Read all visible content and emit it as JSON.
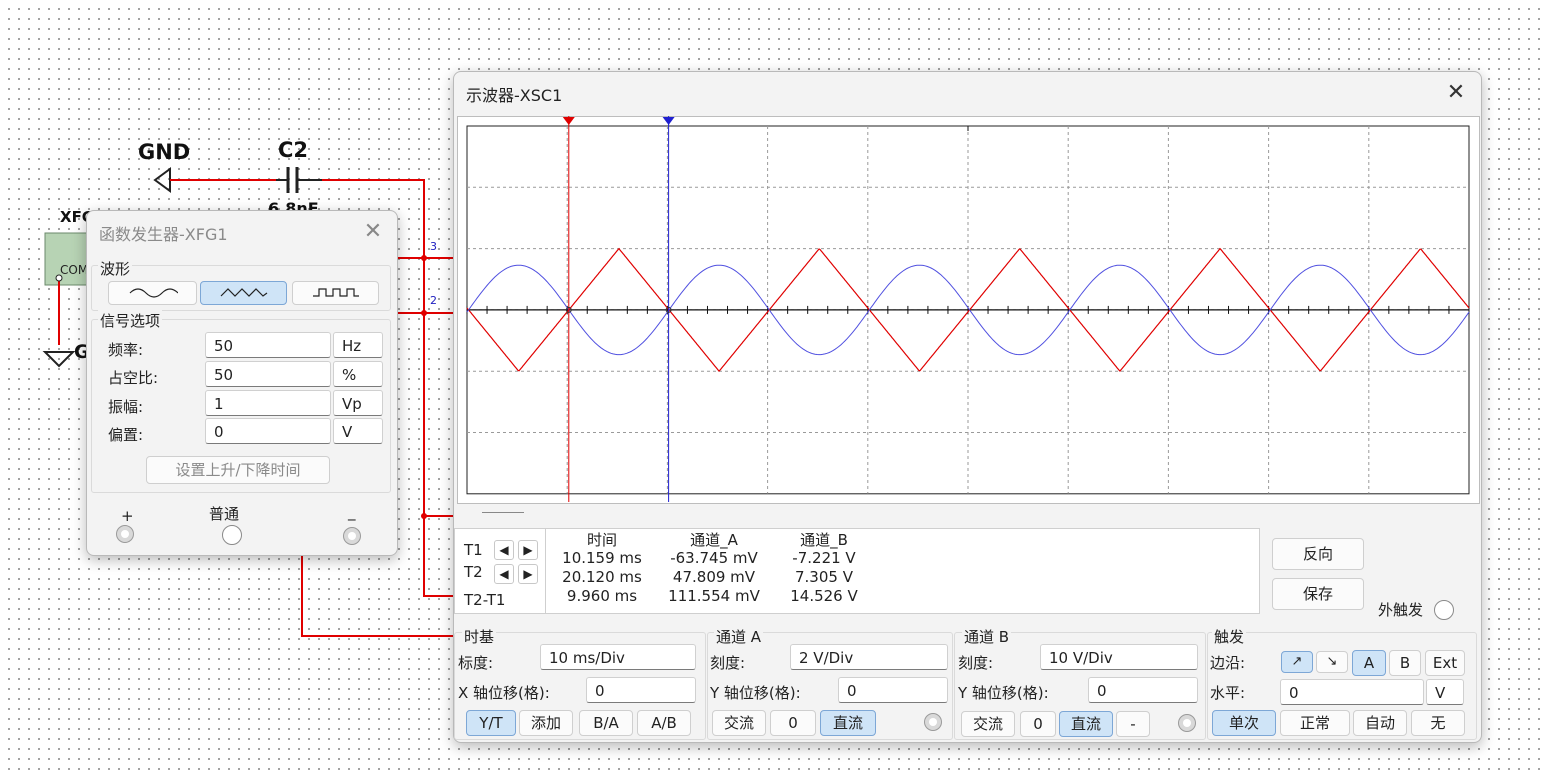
{
  "schematic": {
    "gnd_label": "GND",
    "capacitor_name": "C2",
    "capacitor_value": "6.8nF",
    "generator_ref": "XFG1",
    "generator_com": "COM",
    "node_3": "3",
    "node_2": "2",
    "gnd_partial": "G"
  },
  "function_generator": {
    "title": "函数发生器-XFG1",
    "waveform_section": "波形",
    "waveforms": [
      {
        "icon": "sine-wave-icon",
        "selected": false
      },
      {
        "icon": "triangle-wave-icon",
        "selected": true
      },
      {
        "icon": "square-wave-icon",
        "selected": false
      }
    ],
    "signal_section": "信号选项",
    "params": [
      {
        "label": "频率:",
        "value": "50",
        "unit": "Hz"
      },
      {
        "label": "占空比:",
        "value": "50",
        "unit": "%"
      },
      {
        "label": "振幅:",
        "value": "1",
        "unit": "Vp"
      },
      {
        "label": "偏置:",
        "value": "0",
        "unit": "V"
      }
    ],
    "rise_fall_button": "设置上升/下降时间",
    "terminals": {
      "plus": "+",
      "common": "普通",
      "minus": "_"
    }
  },
  "oscilloscope": {
    "title": "示波器-XSC1",
    "measurements": {
      "headers": [
        "时间",
        "通道_A",
        "通道_B"
      ],
      "rows": [
        {
          "label": "T1",
          "time": "10.159 ms",
          "a": "-63.745 mV",
          "b": "-7.221 V"
        },
        {
          "label": "T2",
          "time": "20.120 ms",
          "a": "47.809 mV",
          "b": "7.305 V"
        },
        {
          "label": "T2-T1",
          "time": "9.960 ms",
          "a": "111.554 mV",
          "b": "14.526 V"
        }
      ]
    },
    "reverse_button": "反向",
    "save_button": "保存",
    "ext_trigger": "外触发",
    "timebase": {
      "title": "时基",
      "scale_label": "标度:",
      "scale_value": "10 ms/Div",
      "xpos_label": "X 轴位移(格):",
      "xpos_value": "0",
      "modes": [
        {
          "label": "Y/T",
          "selected": true
        },
        {
          "label": "添加",
          "selected": false
        },
        {
          "label": "B/A",
          "selected": false
        },
        {
          "label": "A/B",
          "selected": false
        }
      ]
    },
    "channel_a": {
      "title": "通道 A",
      "scale_label": "刻度:",
      "scale_value": "2  V/Div",
      "ypos_label": "Y 轴位移(格):",
      "ypos_value": "0",
      "coupling": [
        {
          "label": "交流",
          "selected": false
        },
        {
          "label": "0",
          "selected": false
        },
        {
          "label": "直流",
          "selected": true
        }
      ]
    },
    "channel_b": {
      "title": "通道 B",
      "scale_label": "刻度:",
      "scale_value": "10  V/Div",
      "ypos_label": "Y 轴位移(格):",
      "ypos_value": "0",
      "coupling": [
        {
          "label": "交流",
          "selected": false
        },
        {
          "label": "0",
          "selected": false
        },
        {
          "label": "直流",
          "selected": true
        },
        {
          "label": "-",
          "selected": false
        }
      ]
    },
    "trigger": {
      "title": "触发",
      "edge_label": "边沿:",
      "edge_rising_icon": "rising-edge-icon",
      "edge_falling_icon": "falling-edge-icon",
      "source_a": "A",
      "source_b": "B",
      "source_ext": "Ext",
      "level_label": "水平:",
      "level_value": "0",
      "level_unit": "V",
      "modes": [
        {
          "label": "单次",
          "selected": true
        },
        {
          "label": "正常",
          "selected": false
        },
        {
          "label": "自动",
          "selected": false
        },
        {
          "label": "无",
          "selected": false
        }
      ]
    },
    "screen": {
      "time_per_div_ms": 10,
      "channel_a_volts_per_div": 2,
      "channel_b_volts_per_div": 10,
      "cursor_t1_ms": 10.159,
      "cursor_t2_ms": 20.12,
      "cursor_t1_color": "#e00000",
      "cursor_t2_color": "#2020d0",
      "trace_red_color": "#e00000",
      "trace_blue_color": "#5050e0",
      "trace_red_wave": "triangle",
      "trace_blue_wave": "sine",
      "frequency_hz": 50,
      "trace_red_amplitude_div": 1.0,
      "trace_blue_amplitude_div": 0.73
    }
  }
}
